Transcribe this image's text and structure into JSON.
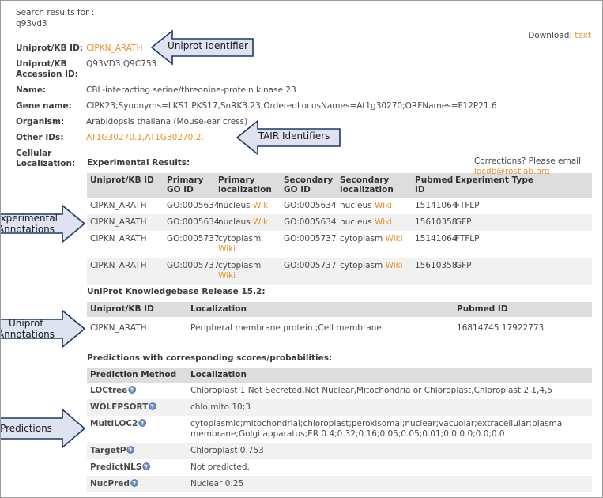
{
  "header": {
    "search_label": "Search results for :",
    "query": "q93vd3",
    "download_label": "Download:",
    "download_link": "text"
  },
  "info": {
    "rows": [
      {
        "key": "Uniprot/KB ID:",
        "value": "CIPKN_ARATH",
        "orange": true
      },
      {
        "key": "Uniprot/KB Accession ID:",
        "value": "Q93VD3,Q9C753",
        "orange": false
      },
      {
        "key": "Name:",
        "value": "CBL-interacting serine/threonine-protein kinase 23",
        "orange": false
      },
      {
        "key": "Gene name:",
        "value": "CIPK23;Synonyms=LKS1,PKS17,SnRK3.23;OrderedLocusNames=At1g30270;ORFNames=F12P21.6",
        "orange": false
      },
      {
        "key": "Organism:",
        "value": "Arabidopsis thaliana (Mouse-ear cress)",
        "orange": false
      },
      {
        "key": "Other IDs:",
        "value": "AT1G30270.1,AT1G30270.2,",
        "orange": true
      },
      {
        "key": "Cellular Localization:",
        "value": "",
        "orange": false
      }
    ]
  },
  "experimental": {
    "title": "Experimental Results:",
    "corrections_line1": "Corrections? Please email",
    "corrections_email": "locdb@rostlab.org",
    "columns": [
      "Uniprot/KB ID",
      "Primary GO ID",
      "Primary localization",
      "Secondary GO ID",
      "Secondary localization",
      "Pubmed ID",
      "Experiment Type"
    ],
    "wiki_label": "Wiki",
    "rows": [
      {
        "uniprot": "CIPKN_ARATH",
        "primary_go": "GO:0005634",
        "primary_loc": "nucleus",
        "secondary_go": "GO:0005634",
        "secondary_loc": "nucleus",
        "pubmed": "15141064",
        "experiment": "FTFLP"
      },
      {
        "uniprot": "CIPKN_ARATH",
        "primary_go": "GO:0005634",
        "primary_loc": "nucleus",
        "secondary_go": "GO:0005634",
        "secondary_loc": "nucleus",
        "pubmed": "15610358",
        "experiment": "GFP"
      },
      {
        "uniprot": "CIPKN_ARATH",
        "primary_go": "GO:0005737",
        "primary_loc": "cytoplasm",
        "secondary_go": "GO:0005737",
        "secondary_loc": "cytoplasm",
        "pubmed": "15141064",
        "experiment": "FTFLP"
      },
      {
        "uniprot": "CIPKN_ARATH",
        "primary_go": "GO:0005737",
        "primary_loc": "cytoplasm",
        "secondary_go": "GO:0005737",
        "secondary_loc": "cytoplasm",
        "pubmed": "15610358",
        "experiment": "GFP"
      }
    ]
  },
  "uniprot_kb": {
    "title": "UniProt Knowledgebase Release 15.2:",
    "columns": [
      "Uniprot/KB ID",
      "Localization",
      "Pubmed ID"
    ],
    "rows": [
      {
        "uniprot": "CIPKN_ARATH",
        "localization": "Peripheral membrane protein.;Cell membrane",
        "pubmed": "16814745 17922773"
      }
    ]
  },
  "predictions": {
    "title": "Predictions with corresponding scores/probabilities:",
    "columns": [
      "Prediction Method",
      "Localization"
    ],
    "rows": [
      {
        "method": "LOCtree",
        "icon": "help-icon",
        "localization": "Chloroplast 1 Not Secreted,Not Nuclear,Mitochondria or Chloroplast,Chloroplast 2,1,4,5"
      },
      {
        "method": "WOLFPSORT",
        "icon": "help-icon",
        "localization": "chlo;mito 10;3"
      },
      {
        "method": "MultiLOC2",
        "icon": "help-icon",
        "localization": "cytoplasmic;mitochondrial;chloroplast;peroxisomal;nuclear;vacuolar;extracellular;plasma membrane;Golgi apparatus;ER 0.4;0.32;0.16;0.05;0.05;0.01;0.0;0.0;0.0;0.0"
      },
      {
        "method": "TargetP",
        "icon": "help-icon",
        "localization": "Chloroplast 0.753"
      },
      {
        "method": "PredictNLS",
        "icon": "help-icon",
        "localization": "Not predicted."
      },
      {
        "method": "NucPred",
        "icon": "help-icon",
        "localization": "Nuclear 0.25"
      }
    ]
  },
  "callouts": [
    {
      "label": "Uniprot Identifier",
      "direction": "left"
    },
    {
      "label": "TAIR Identifiers",
      "direction": "left"
    },
    {
      "label": "Experimental Annotations",
      "direction": "right"
    },
    {
      "label": "Uniprot Annotations",
      "direction": "right"
    },
    {
      "label": "Predictions",
      "direction": "right"
    }
  ],
  "colors": {
    "link_orange": "#e8912d",
    "header_gray": "#dddddd",
    "row_stripe": "#f1f1f1",
    "callout_fill": "#dde3f0",
    "callout_stroke": "#1f3864"
  }
}
